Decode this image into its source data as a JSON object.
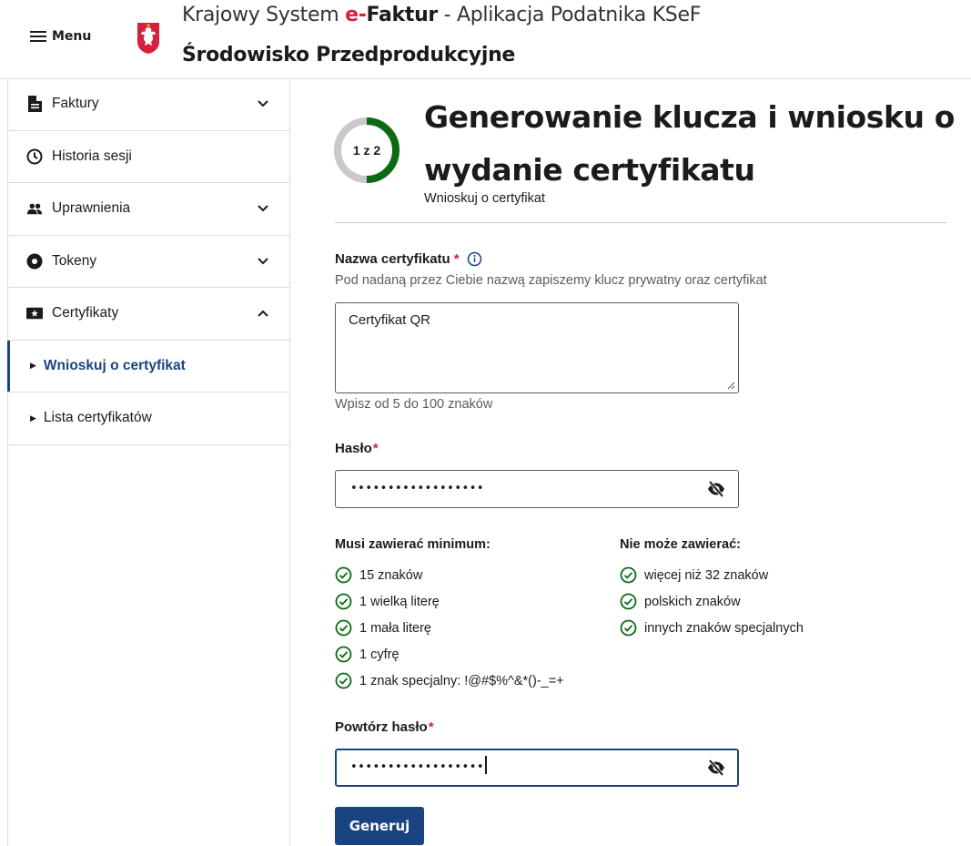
{
  "header": {
    "menu_label": "Menu",
    "title_prefix": "Krajowy System",
    "brand_e": "e-",
    "brand_faktur": "Faktur",
    "title_suffix": " - Aplikacja Podatnika KSeF",
    "environment": "Środowisko Przedprodukcyjne"
  },
  "sidebar": {
    "items": [
      {
        "label": "Faktury",
        "icon": "document-icon",
        "expandable": true
      },
      {
        "label": "Historia sesji",
        "icon": "clock-icon",
        "expandable": false
      },
      {
        "label": "Uprawnienia",
        "icon": "people-icon",
        "expandable": true
      },
      {
        "label": "Tokeny",
        "icon": "token-icon",
        "expandable": true
      },
      {
        "label": "Certyfikaty",
        "icon": "certificate-icon",
        "expandable": true,
        "expanded": true
      }
    ],
    "sub_items": [
      {
        "label": "Wnioskuj o certyfikat",
        "active": true
      },
      {
        "label": "Lista certyfikatów",
        "active": false
      }
    ]
  },
  "step": {
    "label": "1 z 2",
    "progress_fraction": 0.5,
    "active_color": "#0a6b13",
    "track_color": "#c9c9c9"
  },
  "main": {
    "title": "Generowanie klucza i wniosku o wydanie certyfikatu",
    "subtitle": "Wnioskuj o certyfikat"
  },
  "form": {
    "cert_name": {
      "label": "Nazwa certyfikatu",
      "required_mark": "*",
      "description": "Pod nadaną przez Ciebie nazwą zapiszemy klucz prywatny oraz certyfikat",
      "value": "Certyfikat QR",
      "hint": "Wpisz od 5 do 100 znaków"
    },
    "password": {
      "label": "Hasło",
      "required_mark": "*",
      "masked_value": "••••••••••••••••••"
    },
    "must_contain": {
      "title": "Musi zawierać minimum:",
      "items": [
        "15 znaków",
        "1 wielką literę",
        "1 mała literę",
        "1 cyfrę",
        "1 znak specjalny: !@#$%^&*()-_=+"
      ]
    },
    "must_not_contain": {
      "title": "Nie może zawierać:",
      "items": [
        "więcej niż 32 znaków",
        "polskich znaków",
        "innych znaków specjalnych"
      ]
    },
    "repeat_password": {
      "label": "Powtórz hasło",
      "required_mark": "*",
      "masked_value": "••••••••••••••••••"
    },
    "submit_label": "Generuj"
  },
  "colors": {
    "primary": "#1a4480",
    "required": "#d4213d",
    "success": "#0a6b13"
  }
}
